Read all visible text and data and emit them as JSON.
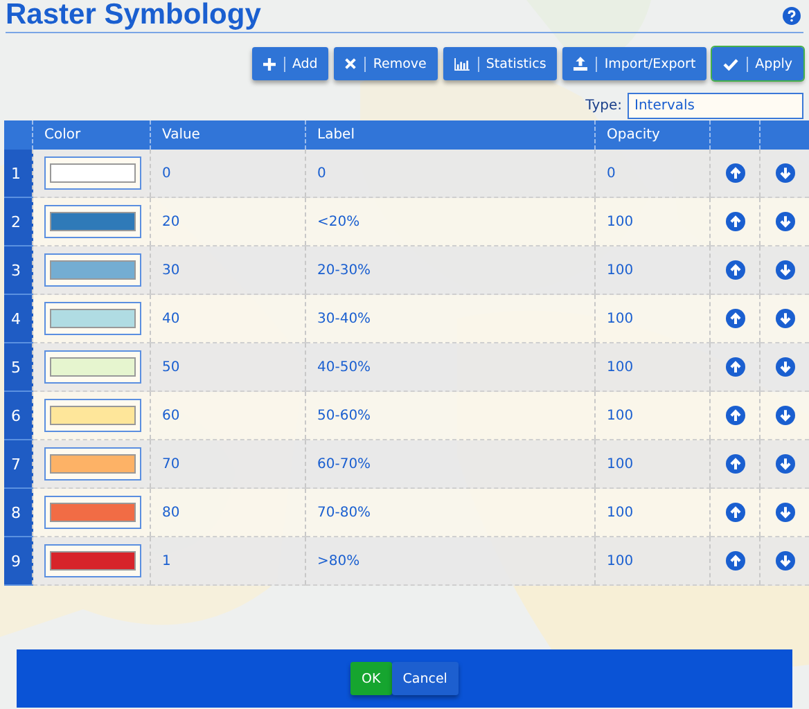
{
  "title": "Raster Symbology",
  "toolbar": [
    {
      "kind": "add",
      "label": "Add"
    },
    {
      "kind": "remove",
      "label": "Remove"
    },
    {
      "kind": "statistics",
      "label": "Statistics"
    },
    {
      "kind": "import",
      "label": "Import/Export"
    },
    {
      "kind": "apply",
      "label": "Apply"
    }
  ],
  "type_field": {
    "label": "Type:",
    "value": "Intervals"
  },
  "table": {
    "columns": [
      "Color",
      "Value",
      "Label",
      "Opacity"
    ],
    "rows": [
      {
        "index": "1",
        "color": "#ffffff",
        "value": "0",
        "label": "0",
        "opacity": "0"
      },
      {
        "index": "2",
        "color": "#2f7ab8",
        "value": "20",
        "label": "<20%",
        "opacity": "100"
      },
      {
        "index": "3",
        "color": "#74add2",
        "value": "30",
        "label": "20-30%",
        "opacity": "100"
      },
      {
        "index": "4",
        "color": "#b0dce3",
        "value": "40",
        "label": "30-40%",
        "opacity": "100"
      },
      {
        "index": "5",
        "color": "#e6f5cf",
        "value": "50",
        "label": "40-50%",
        "opacity": "100"
      },
      {
        "index": "6",
        "color": "#fee69a",
        "value": "60",
        "label": "50-60%",
        "opacity": "100"
      },
      {
        "index": "7",
        "color": "#fdb266",
        "value": "70",
        "label": "60-70%",
        "opacity": "100"
      },
      {
        "index": "8",
        "color": "#f16c45",
        "value": "80",
        "label": "70-80%",
        "opacity": "100"
      },
      {
        "index": "9",
        "color": "#d7242a",
        "value": "1",
        "label": ">80%",
        "opacity": "100"
      }
    ]
  },
  "footer": [
    {
      "kind": "ok",
      "label": "OK"
    },
    {
      "kind": "cancel",
      "label": "Cancel"
    }
  ]
}
